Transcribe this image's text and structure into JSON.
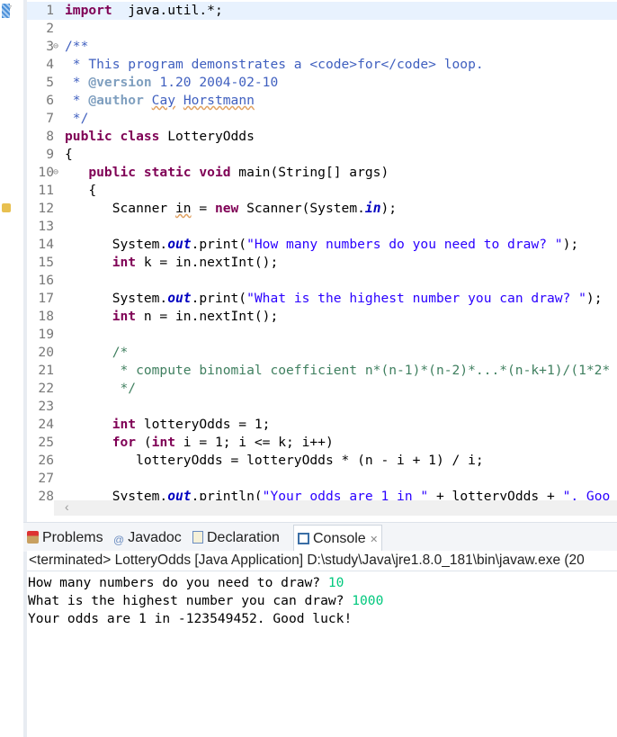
{
  "editor": {
    "current_line": 1,
    "lines": [
      {
        "n": "1",
        "marker": "bookmark",
        "t": [
          [
            "kw",
            "import"
          ],
          [
            "",
            "  java.util.*;"
          ]
        ]
      },
      {
        "n": "2",
        "t": []
      },
      {
        "n": "3",
        "fold": true,
        "t": [
          [
            "jd",
            "/**"
          ]
        ]
      },
      {
        "n": "4",
        "t": [
          [
            "jd",
            " * This program demonstrates a <code>for</code> loop."
          ]
        ]
      },
      {
        "n": "5",
        "t": [
          [
            "jd",
            " * "
          ],
          [
            "tag",
            "@version"
          ],
          [
            "jd",
            " 1.20 2004-02-10"
          ]
        ]
      },
      {
        "n": "6",
        "t": [
          [
            "jd",
            " * "
          ],
          [
            "tag",
            "@author"
          ],
          [
            "jd",
            " "
          ],
          [
            "jdsq",
            "Cay"
          ],
          [
            "jd",
            " "
          ],
          [
            "jdsq",
            "Horstmann"
          ]
        ]
      },
      {
        "n": "7",
        "t": [
          [
            "jd",
            " */"
          ]
        ]
      },
      {
        "n": "8",
        "t": [
          [
            "kw",
            "public class"
          ],
          [
            "",
            " LotteryOdds"
          ]
        ]
      },
      {
        "n": "9",
        "t": [
          [
            "",
            "{"
          ]
        ]
      },
      {
        "n": "10",
        "fold": true,
        "t": [
          [
            "",
            "   "
          ],
          [
            "kw",
            "public static void"
          ],
          [
            "",
            " main(String[] args)"
          ]
        ]
      },
      {
        "n": "11",
        "t": [
          [
            "",
            "   {"
          ]
        ]
      },
      {
        "n": "12",
        "marker": "warning",
        "t": [
          [
            "",
            "      Scanner "
          ],
          [
            "sq",
            "in"
          ],
          [
            "",
            " = "
          ],
          [
            "kw",
            "new"
          ],
          [
            "",
            " Scanner(System."
          ],
          [
            "fld",
            "in"
          ],
          [
            "",
            ");"
          ]
        ]
      },
      {
        "n": "13",
        "t": []
      },
      {
        "n": "14",
        "t": [
          [
            "",
            "      System."
          ],
          [
            "fld",
            "out"
          ],
          [
            "",
            ".print("
          ],
          [
            "str",
            "\"How many numbers do you need to draw? \""
          ],
          [
            "",
            ");"
          ]
        ]
      },
      {
        "n": "15",
        "t": [
          [
            "",
            "      "
          ],
          [
            "kw",
            "int"
          ],
          [
            "",
            " k = in.nextInt();"
          ]
        ]
      },
      {
        "n": "16",
        "t": []
      },
      {
        "n": "17",
        "t": [
          [
            "",
            "      System."
          ],
          [
            "fld",
            "out"
          ],
          [
            "",
            ".print("
          ],
          [
            "str",
            "\"What is the highest number you can draw? \""
          ],
          [
            "",
            ");"
          ]
        ]
      },
      {
        "n": "18",
        "t": [
          [
            "",
            "      "
          ],
          [
            "kw",
            "int"
          ],
          [
            "",
            " n = in.nextInt();"
          ]
        ]
      },
      {
        "n": "19",
        "t": []
      },
      {
        "n": "20",
        "t": [
          [
            "cm",
            "      /*"
          ]
        ]
      },
      {
        "n": "21",
        "t": [
          [
            "cm",
            "       * compute binomial coefficient n*(n-1)*(n-2)*...*(n-k+1)/(1*2*"
          ]
        ]
      },
      {
        "n": "22",
        "t": [
          [
            "cm",
            "       */"
          ]
        ]
      },
      {
        "n": "23",
        "t": []
      },
      {
        "n": "24",
        "t": [
          [
            "",
            "      "
          ],
          [
            "kw",
            "int"
          ],
          [
            "",
            " lotteryOdds = 1;"
          ]
        ]
      },
      {
        "n": "25",
        "t": [
          [
            "",
            "      "
          ],
          [
            "kw",
            "for"
          ],
          [
            "",
            " ("
          ],
          [
            "kw",
            "int"
          ],
          [
            "",
            " i = 1; i <= k; i++)"
          ]
        ]
      },
      {
        "n": "26",
        "t": [
          [
            "",
            "         lotteryOdds = lotteryOdds * (n - i + 1) / i;"
          ]
        ]
      },
      {
        "n": "27",
        "t": []
      },
      {
        "n": "28",
        "t": [
          [
            "",
            "      System."
          ],
          [
            "fld",
            "out"
          ],
          [
            "",
            ".println("
          ],
          [
            "str",
            "\"Your odds are 1 in \""
          ],
          [
            "",
            " + lotteryOdds + "
          ],
          [
            "str",
            "\". Goo"
          ]
        ]
      }
    ]
  },
  "tabs": [
    {
      "label": "Problems",
      "icon": "problems-icon"
    },
    {
      "label": "Javadoc",
      "icon": "at-icon"
    },
    {
      "label": "Declaration",
      "icon": "declaration-icon"
    },
    {
      "label": "Console",
      "icon": "console-icon",
      "active": true,
      "close": "✕"
    }
  ],
  "console": {
    "title": "<terminated> LotteryOdds [Java Application] D:\\study\\Java\\jre1.8.0_181\\bin\\javaw.exe (20",
    "lines": [
      {
        "out": "How many numbers do you need to draw? ",
        "in": "10"
      },
      {
        "out": "What is the highest number you can draw? ",
        "in": "1000"
      },
      {
        "out": "Your odds are 1 in -123549452. Good luck!",
        "in": ""
      }
    ]
  },
  "colors": {
    "keyword": "#7f0055",
    "string": "#2a00ff",
    "comment": "#3f7f5f",
    "javadoc": "#3f5fbf",
    "console_input": "#00c87d",
    "current_line": "#e8f2fe"
  }
}
